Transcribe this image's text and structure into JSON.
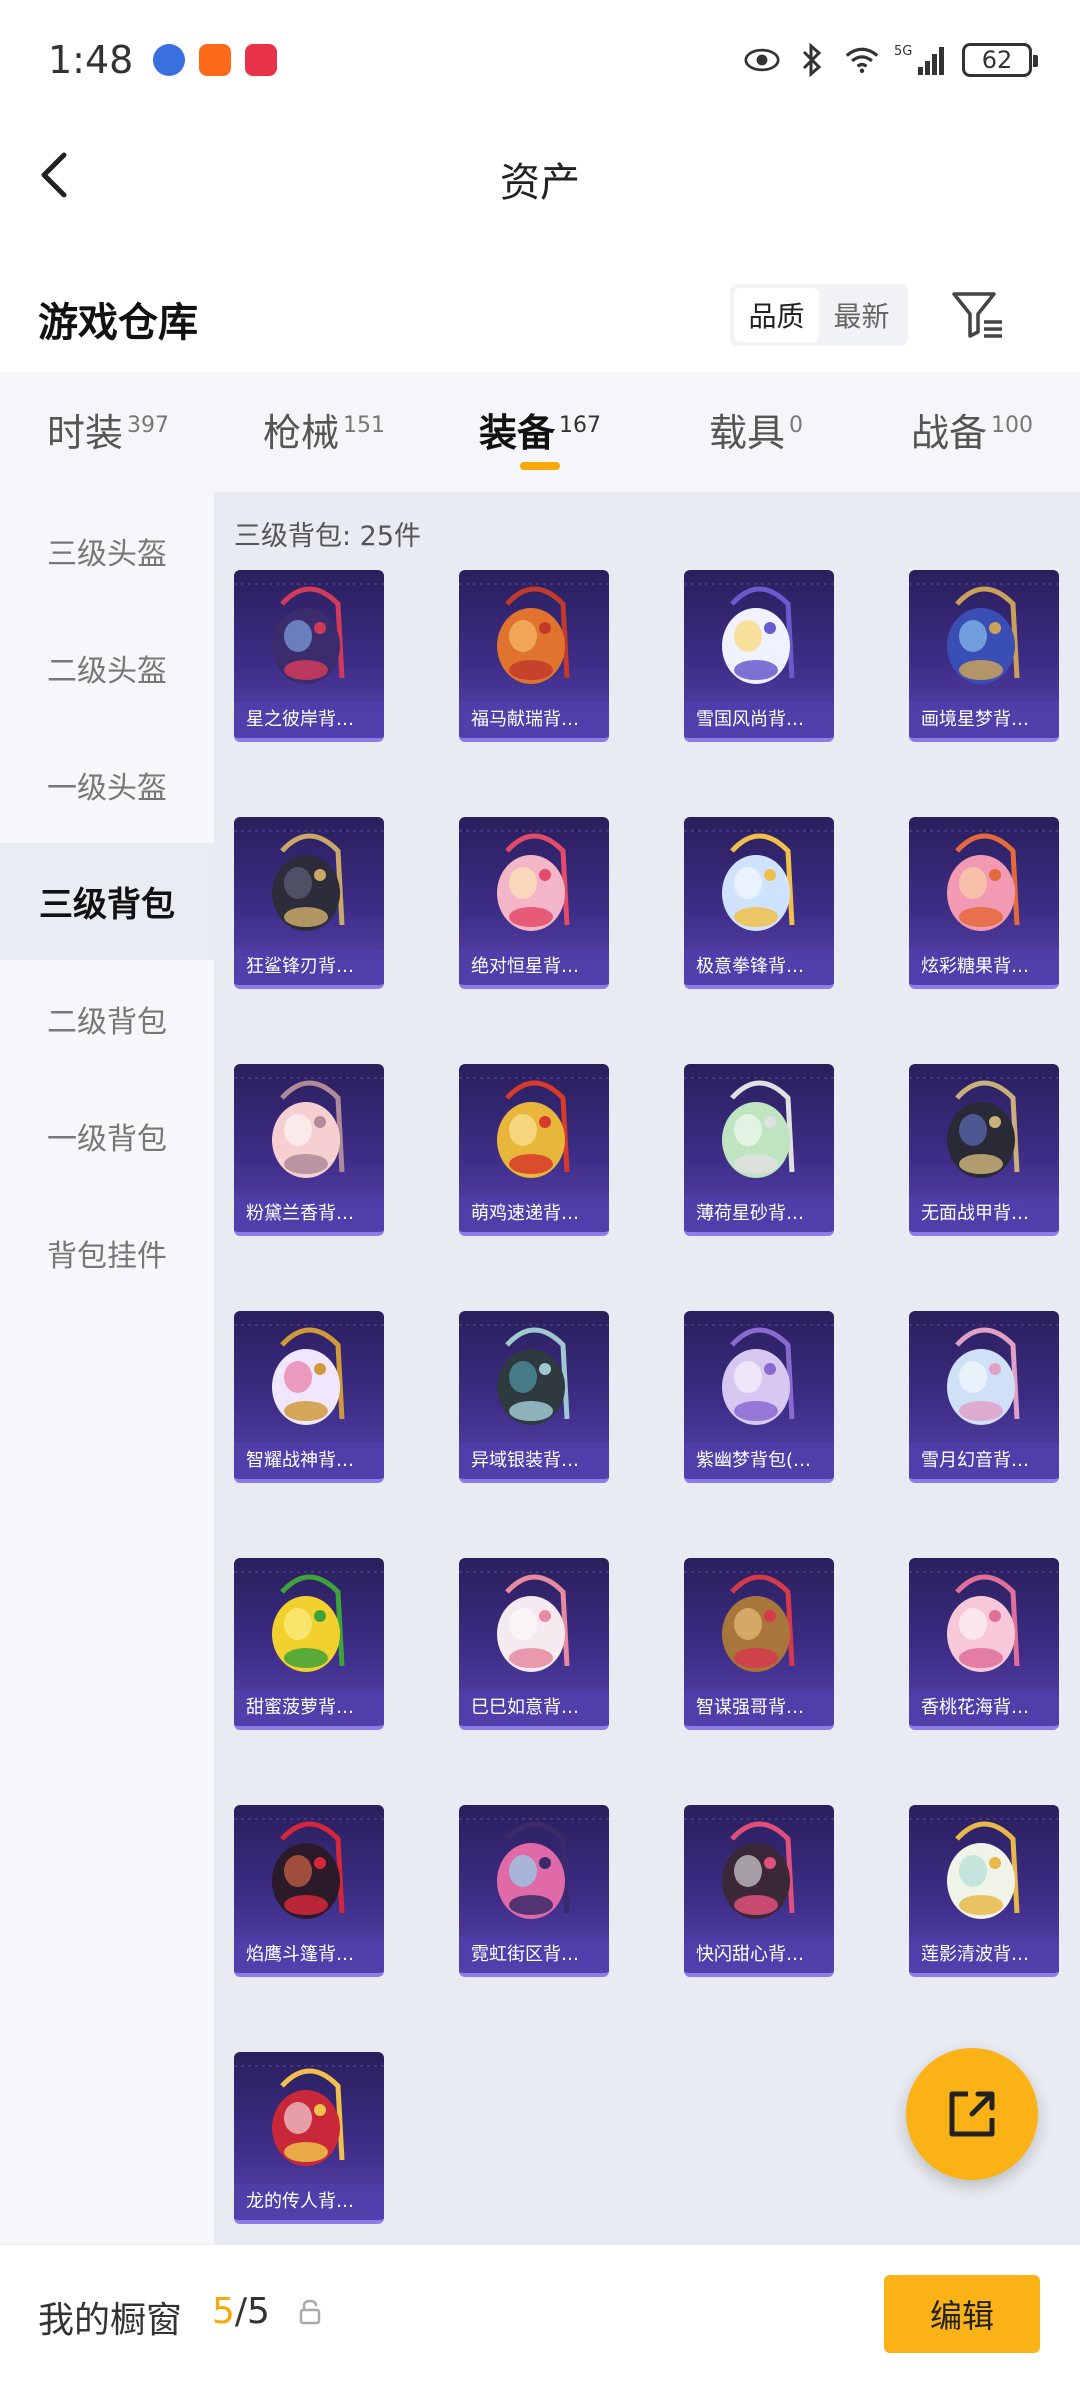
{
  "status_bar": {
    "time": "1:48",
    "network": "5G",
    "battery": "62"
  },
  "header": {
    "title": "资产"
  },
  "warehouse": {
    "title": "游戏仓库",
    "sort_options": [
      "品质",
      "最新"
    ],
    "active_sort": "品质"
  },
  "tabs": [
    {
      "label": "时装",
      "count": "397"
    },
    {
      "label": "枪械",
      "count": "151"
    },
    {
      "label": "装备",
      "count": "167",
      "active": true
    },
    {
      "label": "载具",
      "count": "0"
    },
    {
      "label": "战备",
      "count": "100"
    }
  ],
  "sidebar": {
    "items": [
      "三级头盔",
      "二级头盔",
      "一级头盔",
      "三级背包",
      "二级背包",
      "一级背包",
      "背包挂件"
    ],
    "active": "三级背包"
  },
  "content": {
    "count_label": "三级背包: 25件",
    "items": [
      {
        "name": "星之彼岸背…",
        "art": "cosmic"
      },
      {
        "name": "福马献瑞背…",
        "art": "horse"
      },
      {
        "name": "雪国风尚背…",
        "art": "snowman"
      },
      {
        "name": "画境星梦背…",
        "art": "frame"
      },
      {
        "name": "狂鲨锋刃背…",
        "art": "shark"
      },
      {
        "name": "绝对恒星背…",
        "art": "popcorn"
      },
      {
        "name": "极意拳锋背…",
        "art": "fist"
      },
      {
        "name": "炫彩糖果背…",
        "art": "donut"
      },
      {
        "name": "粉黛兰香背…",
        "art": "pinkball"
      },
      {
        "name": "萌鸡速递背…",
        "art": "chick"
      },
      {
        "name": "薄荷星砂背…",
        "art": "mint"
      },
      {
        "name": "无面战甲背…",
        "art": "armor"
      },
      {
        "name": "智耀战神背…",
        "art": "mech"
      },
      {
        "name": "异域银装背…",
        "art": "box"
      },
      {
        "name": "紫幽梦背包(…",
        "art": "violet"
      },
      {
        "name": "雪月幻音背…",
        "art": "moon"
      },
      {
        "name": "甜蜜菠萝背…",
        "art": "pineapple"
      },
      {
        "name": "巳巳如意背…",
        "art": "snake"
      },
      {
        "name": "智谋强哥背…",
        "art": "bear"
      },
      {
        "name": "香桃花海背…",
        "art": "peach"
      },
      {
        "name": "焰鹰斗篷背…",
        "art": "eagle"
      },
      {
        "name": "霓虹街区背…",
        "art": "neon"
      },
      {
        "name": "快闪甜心背…",
        "art": "heart"
      },
      {
        "name": "莲影清波背…",
        "art": "lotus"
      },
      {
        "name": "龙的传人背…",
        "art": "dragon"
      }
    ]
  },
  "showcase": {
    "label": "我的橱窗",
    "current": "5",
    "total": "/5",
    "edit_label": "编辑"
  },
  "colors": {
    "accent": "#fbb216",
    "card_bg": "#3d2d86"
  }
}
